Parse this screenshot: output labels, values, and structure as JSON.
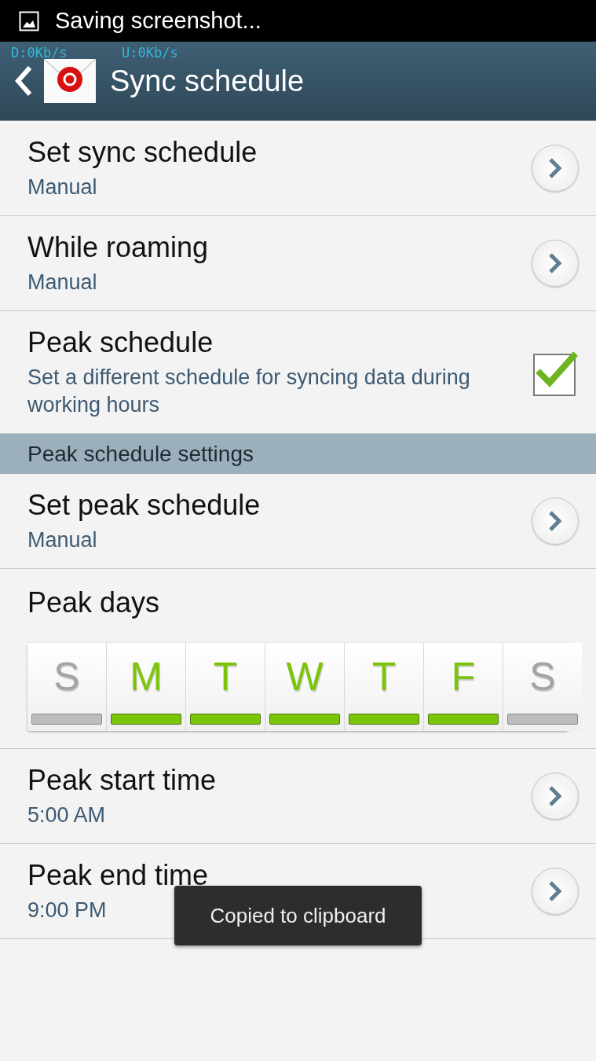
{
  "status_bar": {
    "notification": "Saving screenshot..."
  },
  "action_bar": {
    "title": "Sync schedule",
    "download_speed": "D:0Kb/s",
    "upload_speed": "U:0Kb/s"
  },
  "rows_top": [
    {
      "kind": "link",
      "title": "Set sync schedule",
      "subtitle": "Manual"
    },
    {
      "kind": "link",
      "title": "While roaming",
      "subtitle": "Manual"
    },
    {
      "kind": "check",
      "title": "Peak schedule",
      "subtitle": "Set a different schedule for syncing data during working hours",
      "checked": true
    }
  ],
  "section_header": "Peak schedule settings",
  "rows_mid": [
    {
      "kind": "link",
      "title": "Set peak schedule",
      "subtitle": "Manual"
    }
  ],
  "peak_days": {
    "title": "Peak days",
    "days": [
      {
        "label": "S",
        "selected": false
      },
      {
        "label": "M",
        "selected": true
      },
      {
        "label": "T",
        "selected": true
      },
      {
        "label": "W",
        "selected": true
      },
      {
        "label": "T",
        "selected": true
      },
      {
        "label": "F",
        "selected": true
      },
      {
        "label": "S",
        "selected": false
      }
    ]
  },
  "rows_bottom": [
    {
      "kind": "link",
      "title": "Peak start time",
      "subtitle": "5:00 AM"
    },
    {
      "kind": "link",
      "title": "Peak end time",
      "subtitle": "9:00 PM"
    }
  ],
  "toast": "Copied to clipboard"
}
